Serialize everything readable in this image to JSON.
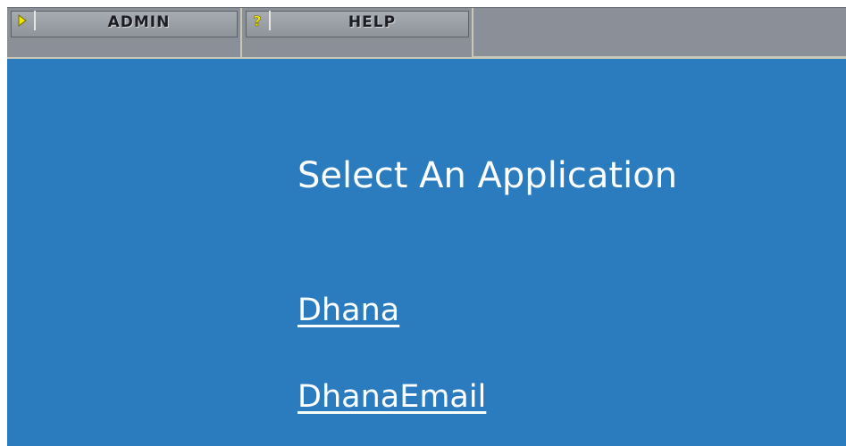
{
  "toolbar": {
    "buttons": [
      {
        "label": "ADMIN",
        "icon": "play-arrow-icon",
        "icon_color": "#f2e600"
      },
      {
        "label": "HELP",
        "icon": "question-mark-icon",
        "icon_color": "#f2e600"
      }
    ]
  },
  "main": {
    "title": "Select An Application",
    "applications": [
      "Dhana",
      "DhanaEmail"
    ]
  },
  "colors": {
    "background": "#2b7bbf",
    "toolbar": "#8a8f98",
    "text": "#ffffff"
  }
}
